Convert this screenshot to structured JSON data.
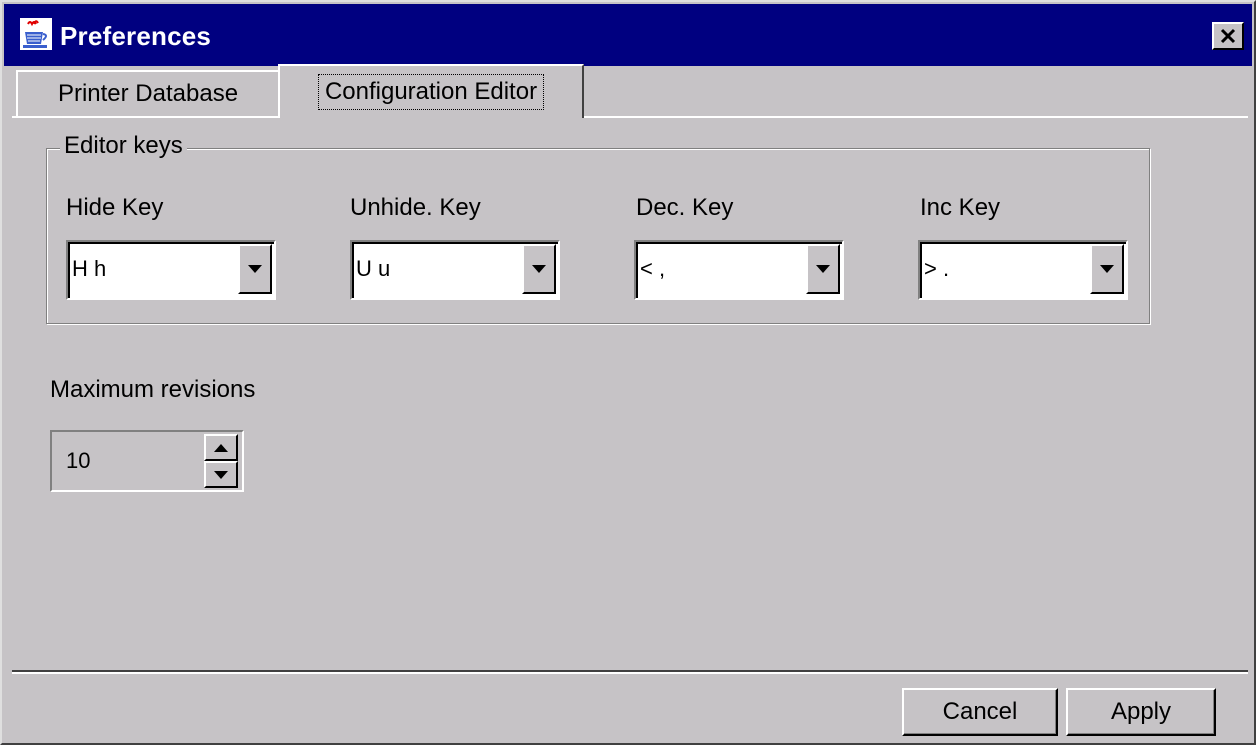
{
  "window": {
    "title": "Preferences",
    "icon": "java-coffee-cup-icon",
    "close_icon": "close-icon"
  },
  "tabs": [
    {
      "label": "Printer Database",
      "active": false
    },
    {
      "label": "Configuration Editor",
      "active": true
    }
  ],
  "editor_keys": {
    "group_title": "Editor keys",
    "fields": [
      {
        "label": "Hide Key",
        "value": "H h"
      },
      {
        "label": "Unhide. Key",
        "value": "U u"
      },
      {
        "label": "Dec. Key",
        "value": "< ,"
      },
      {
        "label": "Inc Key",
        "value": "> ."
      }
    ]
  },
  "max_revisions": {
    "label": "Maximum revisions",
    "value": "10"
  },
  "buttons": {
    "cancel": "Cancel",
    "apply": "Apply"
  },
  "colors": {
    "title_bar": "#000080",
    "background": "#c6c3c6",
    "field_background": "#ffffff"
  }
}
